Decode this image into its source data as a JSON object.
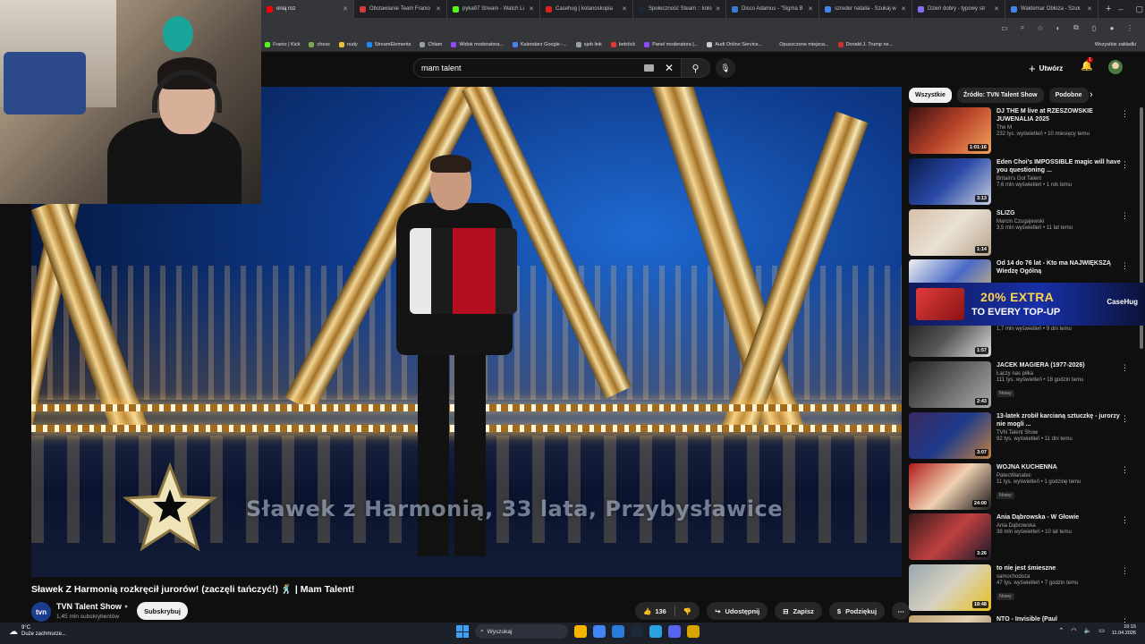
{
  "browser": {
    "tabs": [
      {
        "label": "onią roz",
        "color": "#ff0000",
        "active": true
      },
      {
        "label": "Obstawianie Team Franio",
        "color": "#d63b3b"
      },
      {
        "label": "pyka97 Stream - Watch Li",
        "color": "#53fc18"
      },
      {
        "label": "Casehug | kolanoskopia",
        "color": "#e02020"
      },
      {
        "label": "Społeczność Steam :: kolo",
        "color": "#1b2838"
      },
      {
        "label": "Disco Adamus - \"Sigma B",
        "color": "#3a7bd5"
      },
      {
        "label": "szreder natalia - Szukaj w",
        "color": "#4285f4"
      },
      {
        "label": "Dzień dobry - typowy str",
        "color": "#8a6cf0"
      },
      {
        "label": "Waldemar Obłoza - Szuk",
        "color": "#4285f4"
      }
    ],
    "new_tab": "+",
    "bookmarks": [
      {
        "label": "Franio | Kick",
        "color": "#53fc18"
      },
      {
        "label": "chess",
        "color": "#7fa650"
      },
      {
        "label": "nudy",
        "color": "#f1c232"
      },
      {
        "label": "StreamElements",
        "color": "#1b8cff"
      },
      {
        "label": "Chłam",
        "color": "#9aa0a6"
      },
      {
        "label": "Widok moderatora...",
        "color": "#9146ff"
      },
      {
        "label": "Kalendarz Google -...",
        "color": "#4285f4"
      },
      {
        "label": "sjeb link",
        "color": "#9aa0a6"
      },
      {
        "label": "betclick",
        "color": "#e53935"
      },
      {
        "label": "Panel moderatora |...",
        "color": "#9146ff"
      },
      {
        "label": "Audi Online Service...",
        "color": "#cccccc"
      },
      {
        "label": "Opuszczone miejsca...",
        "color": "#333333"
      },
      {
        "label": "Donald J. Trump ne...",
        "color": "#d32f2f"
      }
    ],
    "bookmarks_right": "Wszystkie zakładki"
  },
  "youtube": {
    "search_value": "mam talent",
    "create_label": "Utwórz",
    "notif_count": "1"
  },
  "video": {
    "caption": "Sławek z Harmonią, 33 lata, Przybysławice",
    "title": "Sławek Z Harmonią rozkręcił jurorów! (zaczęli tańczyć!) 🕺 | Mam Talent!",
    "channel_avatar": "tvn",
    "channel_name": "TVN Talent Show",
    "subscribers": "1,45 mln subskrybentów",
    "subscribe_label": "Subskrybuj",
    "likes": "136",
    "share_label": "Udostępnij",
    "save_label": "Zapisz",
    "thanks_label": "Podziękuj"
  },
  "sidebar": {
    "chips": [
      {
        "label": "Wszystkie",
        "active": true
      },
      {
        "label": "Źródło: TVN Talent Show"
      },
      {
        "label": "Podobne"
      }
    ],
    "recommendations": [
      {
        "title": "DJ THE M live at RZESZOWSKIE JUWENALIA 2025",
        "channel": "The M",
        "stats": "232 tys. wyświetleń • 10 miesięcy temu",
        "duration": "1:01:16",
        "thumb": "linear-gradient(135deg,#3a1010,#b8432a,#f3a35b)"
      },
      {
        "title": "Eden Choi's IMPOSSIBLE magic will have you questioning ...",
        "channel": "Britain's Got Talent",
        "stats": "7,6 mln wyświetleń • 1 rok temu",
        "duration": "3:13",
        "thumb": "linear-gradient(135deg,#0a1a4a,#2a4aa8,#c9cfe0)"
      },
      {
        "title": "ŚLIZG",
        "channel": "Marcin Czugajewski",
        "stats": "3,5 mln wyświetleń • 11 lat temu",
        "duration": "1:14",
        "thumb": "linear-gradient(135deg,#d7c0a8,#e9e1d4,#b9a38c)"
      },
      {
        "title": "Od 14 do 76 lat - Kto ma NAJWIĘKSZĄ Wiedzę Ogólną",
        "channel": "",
        "stats": "",
        "duration": "",
        "thumb": "linear-gradient(135deg,#f0f0f0,#4a6ac8,#e0c070)"
      },
      {
        "title": "dilera",
        "channel": "MeskieGranie i PROBLSM",
        "stats": "1,7 mln wyświetleń • 9 dni temu",
        "duration": "1:57",
        "thumb": "linear-gradient(135deg,#1a1a1a,#555,#ddd)"
      },
      {
        "title": "JACEK MAGIERA (1977-2026)",
        "channel": "Łączy nas piłka",
        "stats": "111 tys. wyświetleń • 18 godzin temu",
        "duration": "2:43",
        "badge": "Nowy",
        "thumb": "linear-gradient(135deg,#222,#666,#aaa)"
      },
      {
        "title": "13-latek zrobił karcianą sztuczkę - jurorzy nie mogli ...",
        "channel": "TVN Talent Show",
        "stats": "92 tys. wyświetleń • 11 dni temu",
        "duration": "3:07",
        "thumb": "linear-gradient(135deg,#3a2a60,#1e3a8a,#c08040)"
      },
      {
        "title": "WOJNA KUCHENNA",
        "channel": "PatecWariatec",
        "stats": "11 tys. wyświetleń • 1 godzinę temu",
        "duration": "24:00",
        "badge": "Nowy",
        "thumb": "linear-gradient(135deg,#b01a1a,#f0d0b0,#1a1a1a)"
      },
      {
        "title": "Ania Dąbrowska - W Głowie",
        "channel": "Ania Dąbrowska",
        "stats": "38 mln wyświetleń • 10 lat temu",
        "duration": "3:26",
        "thumb": "linear-gradient(135deg,#3a1a1a,#c04040,#1a1a2a)"
      },
      {
        "title": "to nie jest śmieszne",
        "channel": "samochodoza",
        "stats": "47 tys. wyświetleń • 7 godzin temu",
        "duration": "18:48",
        "badge": "Nowy",
        "thumb": "linear-gradient(135deg,#9aa6b0,#d7d2c0,#e8c020)"
      },
      {
        "title": "NTO - Invisible (Paul",
        "channel": "",
        "stats": "",
        "duration": "",
        "thumb": "linear-gradient(135deg,#c0a070,#e0d0b0,#806040)"
      }
    ]
  },
  "ad": {
    "line1": "20% EXTRA",
    "line2": "TO EVERY TOP-UP",
    "brand": "CaseHug"
  },
  "taskbar": {
    "temp": "9°C",
    "weather": "Duże zachmurze...",
    "search_label": "Wyszukaj",
    "time": "16:15",
    "date": "11.04.2026"
  }
}
